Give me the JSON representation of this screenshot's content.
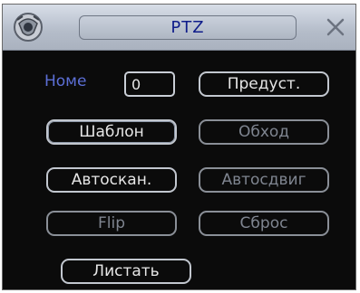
{
  "window": {
    "title": "PTZ"
  },
  "form": {
    "number_label": "Номе",
    "number_value": "0"
  },
  "buttons": {
    "preset": "Предуст.",
    "template": "Шаблон",
    "tour": "Обход",
    "autoscan": "Автоскан.",
    "autopan": "Автосдвиг",
    "flip": "Flip",
    "reset": "Сброс",
    "page": "Листать"
  },
  "icons": {
    "app": "ptz-camera-icon",
    "close": "close-icon"
  },
  "colors": {
    "title_text": "#0f1c8a",
    "label_text": "#5c6fd6",
    "button_text": "#e6e6e6",
    "dim_text": "#7f8590",
    "background": "#0b0b0b"
  }
}
